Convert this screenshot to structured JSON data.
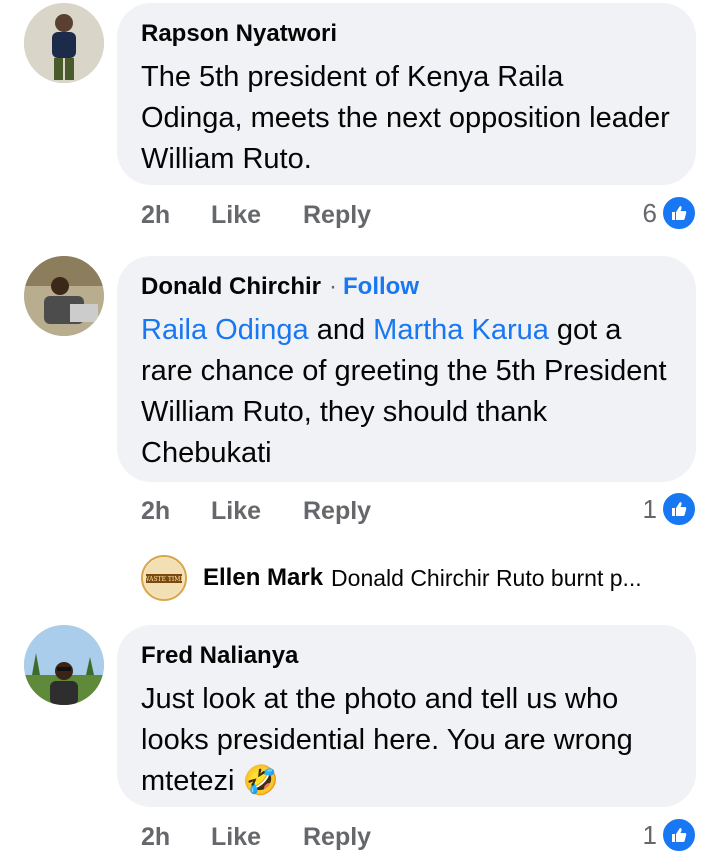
{
  "colors": {
    "accent": "#1877f2",
    "bubble": "#f0f2f5",
    "muted": "#65676b"
  },
  "comments": [
    {
      "author": "Rapson Nyatwori",
      "text": "The 5th president of Kenya Raila Odinga, meets the next opposition leader William Ruto.",
      "time": "2h",
      "like": "Like",
      "reply": "Reply",
      "reactions": "6"
    },
    {
      "author": "Donald Chirchir",
      "separator": "·",
      "follow": "Follow",
      "mention1": "Raila Odinga",
      "and": " and ",
      "mention2": "Martha Karua",
      "text_rest": " got a rare chance of greeting the 5th President William Ruto, they should thank Chebukati",
      "time": "2h",
      "like": "Like",
      "reply": "Reply",
      "reactions": "1",
      "reply_preview": {
        "author": "Ellen Mark",
        "text": "Donald Chirchir Ruto burnt p...",
        "avatar_text": "WASTE TIME"
      }
    },
    {
      "author": "Fred Nalianya",
      "text": "Just look at the photo and tell us who looks presidential here. You are wrong mtetezi",
      "emoji": "🤣",
      "time": "2h",
      "like": "Like",
      "reply": "Reply",
      "reactions": "1"
    }
  ]
}
